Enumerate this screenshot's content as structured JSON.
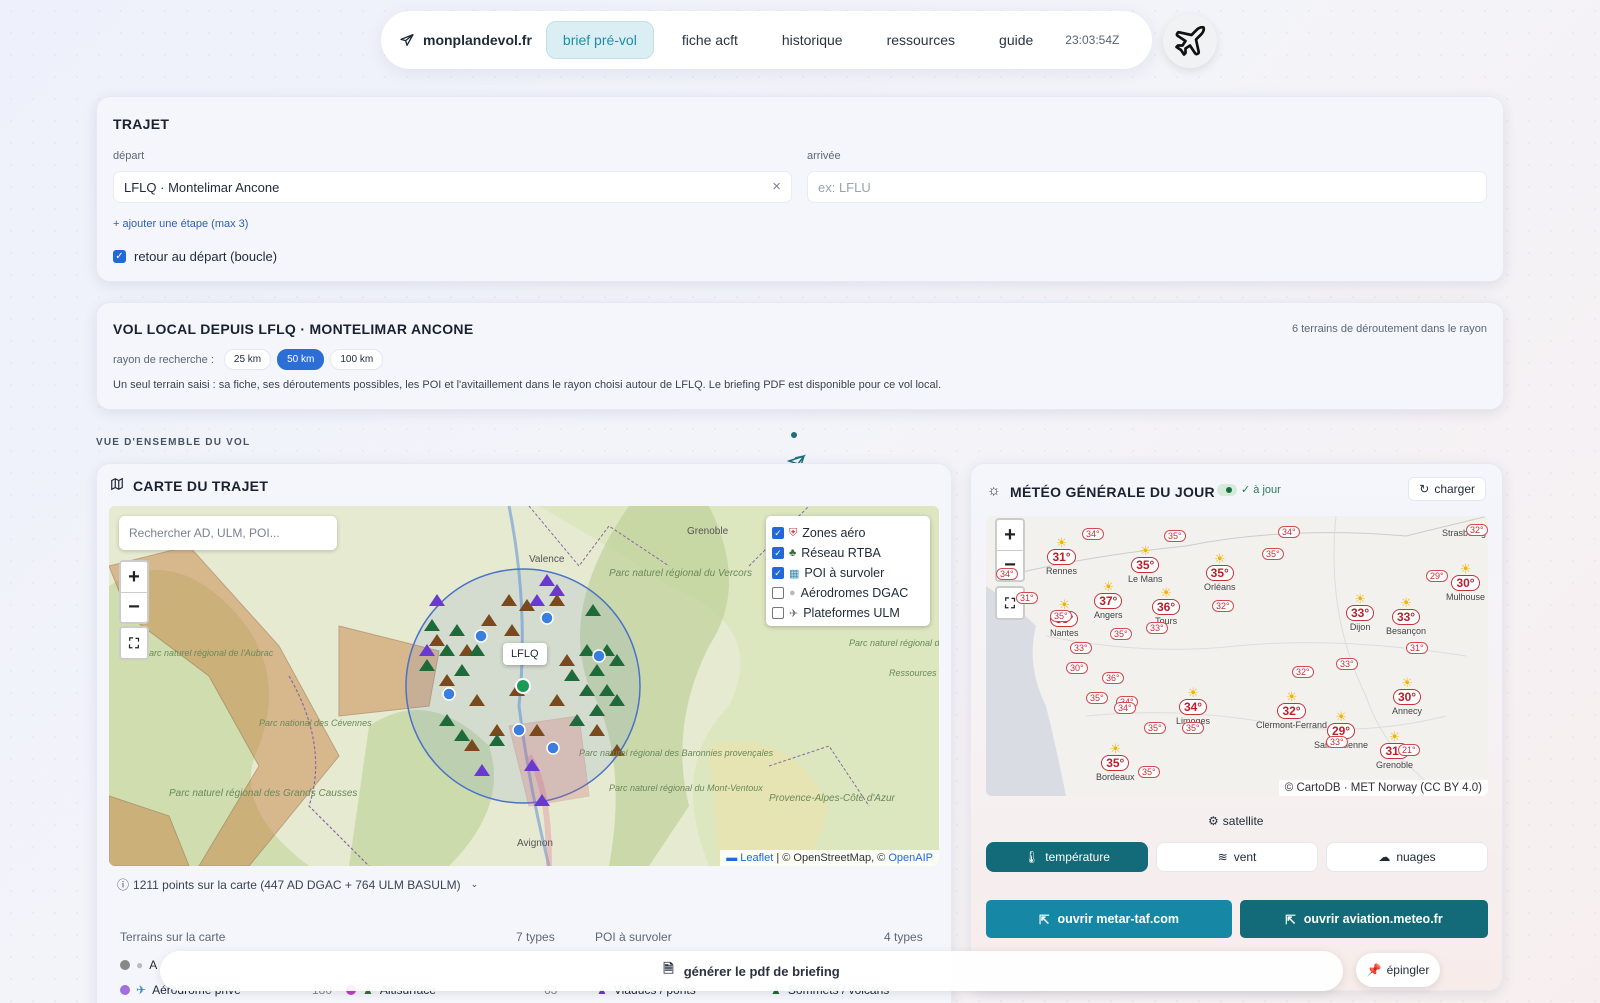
{
  "nav": {
    "brand": "monplandevol.fr",
    "tabs": [
      "brief pré-vol",
      "fiche acft",
      "historique",
      "ressources",
      "guide"
    ],
    "clock": "23:03:54Z"
  },
  "trajet": {
    "title": "TRAJET",
    "depart_label": "départ",
    "depart_value": "LFLQ · Montelimar Ancone",
    "arrivee_label": "arrivée",
    "arrivee_placeholder": "ex: LFLU",
    "add_step": "+ ajouter une étape (max 3)",
    "loop_label": "retour au départ (boucle)"
  },
  "local": {
    "title": "VOL LOCAL DEPUIS LFLQ · MONTELIMAR ANCONE",
    "count": "6 terrains de déroutement dans le rayon",
    "radius_label": "rayon de recherche :",
    "radius_options": [
      "25 km",
      "50 km",
      "100 km"
    ],
    "radius_selected": "50 km",
    "description": "Un seul terrain saisi : sa fiche, ses déroutements possibles, les POI et l'avitaillement dans le rayon choisi autour de LFLQ. Le briefing PDF est disponible pour ce vol local."
  },
  "overview_label": "VUE D'ENSEMBLE DU VOL",
  "map_card": {
    "title": "CARTE DU TRAJET",
    "search_placeholder": "Rechercher AD, ULM, POI...",
    "airport_label": "LFLQ",
    "layers": [
      {
        "label": "Zones aéro",
        "checked": true
      },
      {
        "label": "Réseau RTBA",
        "checked": true
      },
      {
        "label": "POI à survoler",
        "checked": true
      },
      {
        "label": "Aérodromes DGAC",
        "checked": false
      },
      {
        "label": "Plateformes ULM",
        "checked": false
      }
    ],
    "attribution_leaflet": "Leaflet",
    "attribution_rest": " | © OpenStreetMap, © ",
    "attribution_openaip": "OpenAIP",
    "points_summary": "1211 points sur la carte (447 AD DGAC + 764 ULM BASULM)",
    "terrains_label": "Terrains sur la carte",
    "terrains_types": "7 types",
    "poi_label": "POI à survoler",
    "poi_types": "4 types",
    "legend_row1_a": "A",
    "legend_row2_a": "Aérodrome privé",
    "legend_row2_a_count": "180",
    "legend_row2_b": "Altisurface",
    "legend_row2_b_count": "63",
    "legend_row2_c": "Viaducs / ponts",
    "legend_row2_d": "Sommets / volcans",
    "map_labels": [
      "Grenoble",
      "Valence",
      "Parc naturel régional du Vercors",
      "Parc naturel régional de l'Aubrac",
      "Parc national des Cévennes",
      "Parc naturel régional des Grands Causses",
      "Parc naturel régional des Baronnies provençales",
      "Parc naturel régional du Mont-Ventoux",
      "Avignon",
      "Provence-Alpes-Côte d'Azur",
      "Parc naturel régional du Queyras",
      "Ressources"
    ]
  },
  "weather": {
    "title": "MÉTÉO GÉNÉRALE DU JOUR",
    "status": "✓ à jour",
    "reload": "charger",
    "attribution": "© CartoDB · MET Norway (CC BY 4.0)",
    "satellite": "satellite",
    "tabs": [
      "température",
      "vent",
      "nuages"
    ],
    "ext_buttons": [
      "ouvrir metar-taf.com",
      "ouvrir aviation.meteo.fr"
    ],
    "cities": [
      {
        "name": "Rennes",
        "t": "31°"
      },
      {
        "name": "Le Mans",
        "t": "35°"
      },
      {
        "name": "Orléans",
        "t": "35°"
      },
      {
        "name": "Angers",
        "t": "37°"
      },
      {
        "name": "Tours",
        "t": "36°"
      },
      {
        "name": "Nantes",
        "t": "35°"
      },
      {
        "name": "Dijon",
        "t": "33°"
      },
      {
        "name": "Besançon",
        "t": "33°"
      },
      {
        "name": "Mulhouse",
        "t": "30°"
      },
      {
        "name": "Strasbourg",
        "t": ""
      },
      {
        "name": "Limoges",
        "t": "34°"
      },
      {
        "name": "Clermont-Ferrand",
        "t": "32°"
      },
      {
        "name": "Saint-Étienne",
        "t": "29°"
      },
      {
        "name": "Annecy",
        "t": "30°"
      },
      {
        "name": "Grenoble",
        "t": "31°"
      },
      {
        "name": "Bordeaux",
        "t": "35°"
      }
    ],
    "small_temps": [
      "34°",
      "35°",
      "34°",
      "35°",
      "34°",
      "32°",
      "35°",
      "35°",
      "36°",
      "33°",
      "30°",
      "35°",
      "33°",
      "34°",
      "35°",
      "35°",
      "32°",
      "33°",
      "35°",
      "34°",
      "31°",
      "33°",
      "32°",
      "21°",
      "29°",
      "31°"
    ]
  },
  "bottom": {
    "generate": "générer le pdf de briefing",
    "pin": "épingler"
  }
}
